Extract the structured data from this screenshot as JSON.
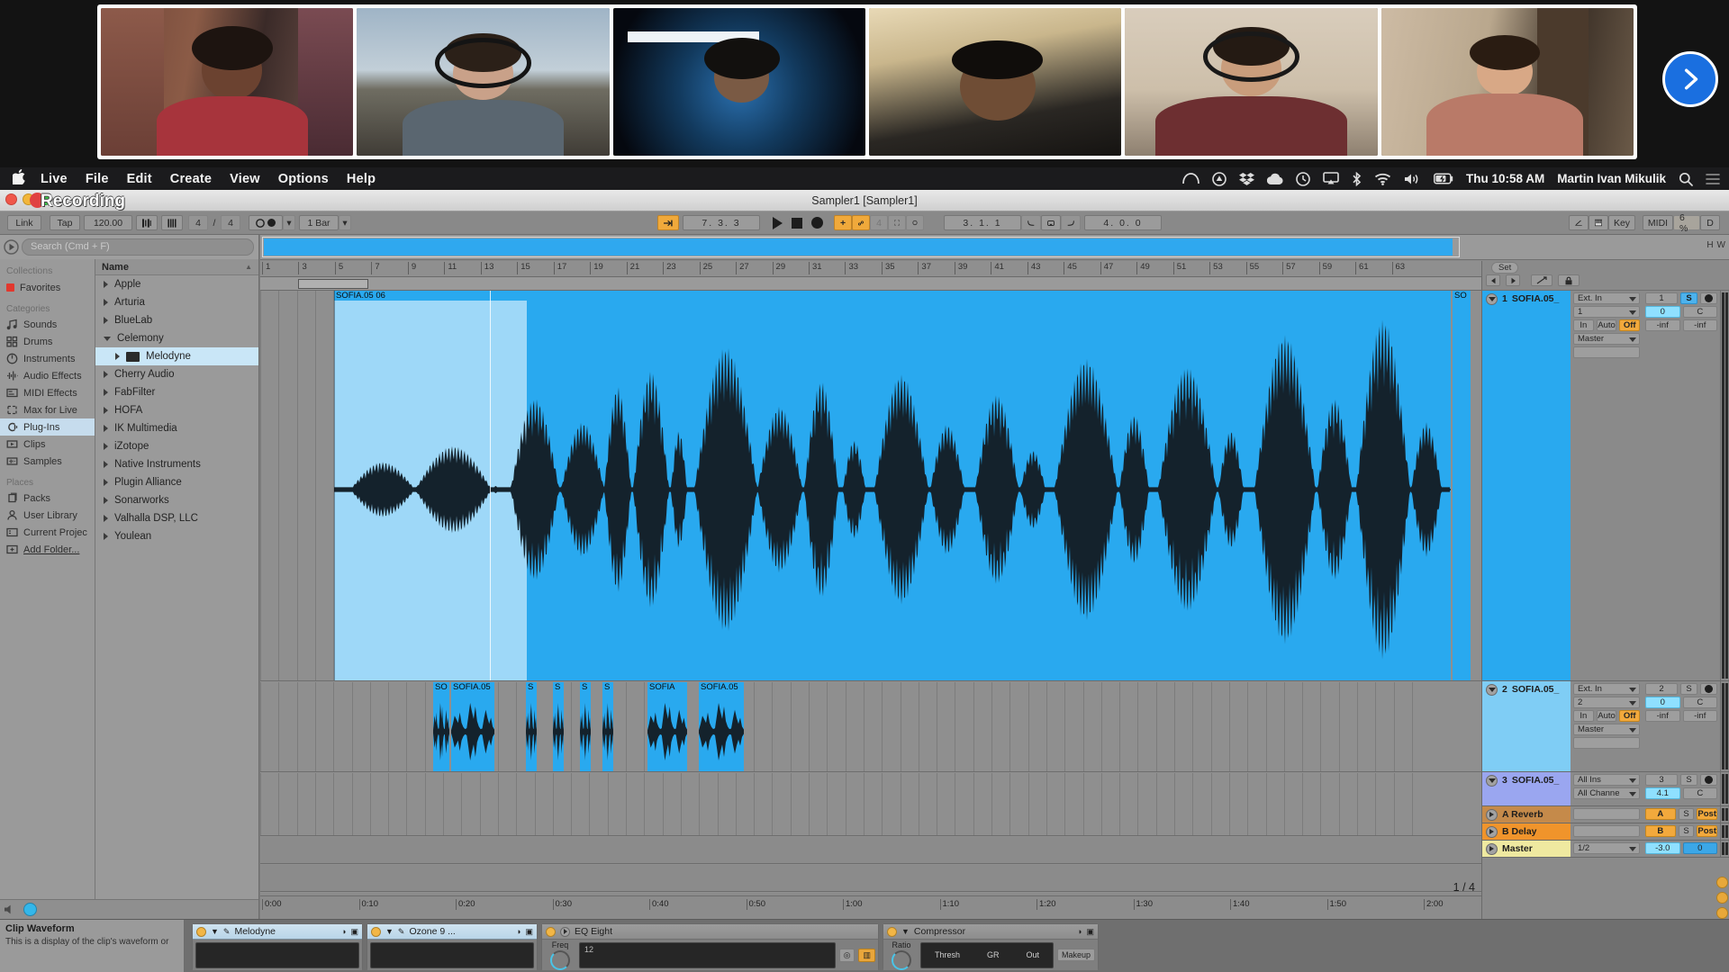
{
  "videocall": {
    "participants": [
      {
        "name": "participant-1",
        "active": false
      },
      {
        "name": "participant-2",
        "active": false
      },
      {
        "name": "participant-3",
        "active": true
      },
      {
        "name": "participant-4",
        "active": false
      },
      {
        "name": "participant-5",
        "active": false
      },
      {
        "name": "participant-6",
        "active": false
      }
    ],
    "next_label": "›"
  },
  "menubar": {
    "apple": "",
    "items": [
      "Live",
      "File",
      "Edit",
      "Create",
      "View",
      "Options",
      "Help"
    ],
    "status_icons": [
      "vpn-icon",
      "dropbox-triangle-icon",
      "dropbox-icon",
      "cloud-icon",
      "time-machine-icon",
      "airplay-icon",
      "bluetooth-icon",
      "wifi-icon",
      "volume-icon",
      "battery-icon"
    ],
    "clock": "Thu 10:58 AM",
    "user": "Martin Ivan Mikulik",
    "search_icon": "search-icon",
    "control_center_icon": "control-center-icon"
  },
  "titlebar": {
    "recording_label": "Recording",
    "document_title": "Sampler1  [Sampler1]"
  },
  "transport": {
    "link": "Link",
    "tap": "Tap",
    "tempo": "120.00",
    "metronome_icon": "metronome-icon",
    "signature_num": "4",
    "signature_sep": "/",
    "signature_den": "4",
    "quantize_icon": "record-quantize-icon",
    "quantize_value": "1 Bar",
    "follow_icon": "follow-icon",
    "position": "7. 3. 3",
    "play_icon": "play-icon",
    "stop_icon": "stop-icon",
    "record_icon": "record-icon",
    "plus_icon": "draw-mode-icon",
    "link_icon": "automation-arm-icon",
    "fourth": "4",
    "grid_icon": "grid-icon",
    "loop_icon": "loop-icon",
    "loop_start": "3. 1. 1",
    "fade_in_icon": "fade-in-icon",
    "punch_loop_icon": "punch-loop-icon",
    "fade_out_icon": "fade-out-icon",
    "loop_length": "4. 0. 0",
    "pencil_icon": "pencil-icon",
    "midi_keyboard_icon": "midi-keyboard-icon",
    "key": "Key",
    "midi": "MIDI",
    "cpu": "6 %",
    "disk": "D"
  },
  "browser": {
    "search_placeholder": "Search (Cmd + F)",
    "play_icon": "preview-play-icon",
    "collections_header": "Collections",
    "collections": [
      {
        "label": "Favorites",
        "icon": "favorite-swatch-icon",
        "color": "#e2382e"
      }
    ],
    "categories_header": "Categories",
    "categories": [
      {
        "label": "Sounds",
        "icon": "sounds-icon",
        "selected": false
      },
      {
        "label": "Drums",
        "icon": "drums-icon",
        "selected": false
      },
      {
        "label": "Instruments",
        "icon": "instruments-icon",
        "selected": false
      },
      {
        "label": "Audio Effects",
        "icon": "audio-effects-icon",
        "selected": false
      },
      {
        "label": "MIDI Effects",
        "icon": "midi-effects-icon",
        "selected": false
      },
      {
        "label": "Max for Live",
        "icon": "max-for-live-icon",
        "selected": false
      },
      {
        "label": "Plug-Ins",
        "icon": "plugins-icon",
        "selected": true
      },
      {
        "label": "Clips",
        "icon": "clips-icon",
        "selected": false
      },
      {
        "label": "Samples",
        "icon": "samples-icon",
        "selected": false
      }
    ],
    "places_header": "Places",
    "places": [
      {
        "label": "Packs",
        "icon": "packs-icon"
      },
      {
        "label": "User Library",
        "icon": "user-library-icon"
      },
      {
        "label": "Current Projec",
        "icon": "current-project-icon"
      },
      {
        "label": "Add Folder...",
        "icon": "add-folder-icon"
      }
    ],
    "list_header": "Name",
    "sort_icon": "sort-asc-icon",
    "items": [
      {
        "label": "Apple",
        "expanded": false,
        "child": false,
        "selected": false
      },
      {
        "label": "Arturia",
        "expanded": false,
        "child": false,
        "selected": false
      },
      {
        "label": "BlueLab",
        "expanded": false,
        "child": false,
        "selected": false
      },
      {
        "label": "Celemony",
        "expanded": true,
        "child": false,
        "selected": false
      },
      {
        "label": "Melodyne",
        "expanded": false,
        "child": true,
        "selected": true
      },
      {
        "label": "Cherry Audio",
        "expanded": false,
        "child": false,
        "selected": false
      },
      {
        "label": "FabFilter",
        "expanded": false,
        "child": false,
        "selected": false
      },
      {
        "label": "HOFA",
        "expanded": false,
        "child": false,
        "selected": false
      },
      {
        "label": "IK Multimedia",
        "expanded": false,
        "child": false,
        "selected": false
      },
      {
        "label": "iZotope",
        "expanded": false,
        "child": false,
        "selected": false
      },
      {
        "label": "Native Instruments",
        "expanded": false,
        "child": false,
        "selected": false
      },
      {
        "label": "Plugin Alliance",
        "expanded": false,
        "child": false,
        "selected": false
      },
      {
        "label": "Sonarworks",
        "expanded": false,
        "child": false,
        "selected": false
      },
      {
        "label": "Valhalla DSP, LLC",
        "expanded": false,
        "child": false,
        "selected": false
      },
      {
        "label": "Youlean",
        "expanded": false,
        "child": false,
        "selected": false
      }
    ]
  },
  "arrangement": {
    "overview_right": [
      "H",
      "W"
    ],
    "bar_ticks": [
      "1",
      "3",
      "5",
      "7",
      "9",
      "11",
      "13",
      "15",
      "17",
      "19",
      "21",
      "23",
      "25",
      "27",
      "29",
      "31",
      "33",
      "35",
      "37",
      "39",
      "41",
      "43",
      "45",
      "47",
      "49",
      "51",
      "53",
      "55",
      "57",
      "59",
      "61",
      "63"
    ],
    "time_ticks": [
      "0:00",
      "0:10",
      "0:20",
      "0:30",
      "0:40",
      "0:50",
      "1:00",
      "1:10",
      "1:20",
      "1:30",
      "1:40",
      "1:50",
      "2:00"
    ],
    "track1_clip_label": "SOFIA.05  06",
    "track1_clip_label_right": "SO",
    "track2_clips": [
      "SO",
      "SOFIA.05",
      "S",
      "S",
      "S",
      "S",
      "SOFIA",
      "SOFIA.05"
    ],
    "quantize_display": "1 / 4"
  },
  "mixer": {
    "set_label": "Set",
    "tracks": [
      {
        "num": "1",
        "name": "SOFIA.05_",
        "color": "#29a9ef",
        "input": "Ext. In",
        "channel": "1",
        "monitor": [
          "In",
          "Auto",
          "Off"
        ],
        "output": "Master",
        "send_label": "1",
        "solo": "S",
        "arm": "record-arm-icon",
        "volume": "0",
        "pan": "C",
        "meters": [
          "-inf",
          "-inf"
        ],
        "type": "audio"
      },
      {
        "num": "2",
        "name": "SOFIA.05_",
        "color": "#6ec8f5",
        "input": "Ext. In",
        "channel": "2",
        "monitor": [
          "In",
          "Auto",
          "Off"
        ],
        "output": "Master",
        "send_label": "2",
        "solo": "S",
        "arm": "record-arm-icon",
        "volume": "0",
        "pan": "C",
        "meters": [
          "-inf",
          "-inf"
        ],
        "type": "audio"
      },
      {
        "num": "3",
        "name": "SOFIA.05_",
        "color": "#8f9ef0",
        "input": "All Ins",
        "channel": "All Channe",
        "send_label": "3",
        "solo": "S",
        "arm": "record-arm-midi-icon",
        "volume": "4.1",
        "pan": "C",
        "type": "midi"
      }
    ],
    "returns": [
      {
        "name": "A Reverb",
        "color": "#c48a45",
        "letter": "A",
        "solo": "S",
        "mode": "Post"
      },
      {
        "name": "B Delay",
        "color": "#f0932b",
        "letter": "B",
        "solo": "S",
        "mode": "Post"
      }
    ],
    "master": {
      "name": "Master",
      "color": "#efe9a0",
      "cue": "1/2",
      "volume": "-3.0",
      "pan": "0"
    }
  },
  "info_view": {
    "title": "Clip Waveform",
    "text": "This is a display of the clip's waveform or"
  },
  "devices": [
    {
      "name": "Melodyne",
      "active": true,
      "kind": "plugin",
      "header_style": "plugin",
      "icons": [
        "power-led-icon",
        "chevron-down-icon",
        "wrench-icon",
        "hotswap-icon",
        "save-icon"
      ]
    },
    {
      "name": "Ozone 9 ...",
      "active": true,
      "kind": "plugin",
      "header_style": "plugin",
      "icons": [
        "power-led-icon",
        "chevron-down-icon",
        "wrench-icon",
        "hotswap-icon",
        "save-icon"
      ]
    },
    {
      "name": "EQ Eight",
      "active": true,
      "kind": "native",
      "header_style": "native",
      "labels": [
        "Freq",
        "12"
      ],
      "icons": [
        "power-led-icon",
        "play-icon",
        "headphone-icon",
        "analyze-icon"
      ]
    },
    {
      "name": "Compressor",
      "active": true,
      "kind": "native",
      "header_style": "native",
      "labels": [
        "Ratio",
        "Thresh",
        "GR",
        "Out",
        "Makeup"
      ],
      "icons": [
        "power-led-icon",
        "chevron-down-icon",
        "hotswap-icon",
        "save-icon"
      ]
    }
  ]
}
